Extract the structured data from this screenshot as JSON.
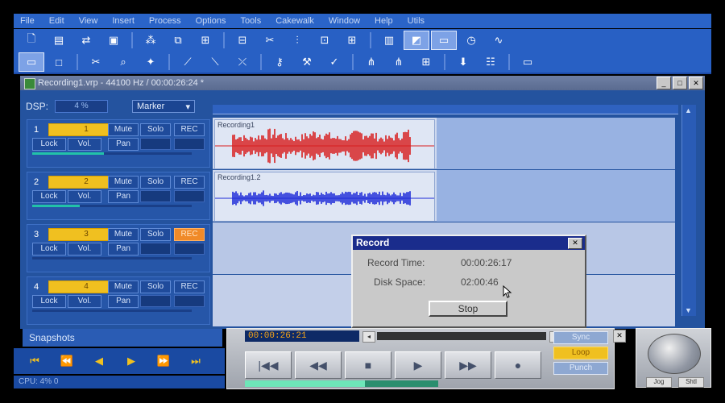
{
  "menu": [
    "File",
    "Edit",
    "View",
    "Insert",
    "Process",
    "Options",
    "Tools",
    "Cakewalk",
    "Window",
    "Help",
    "Utils"
  ],
  "document": {
    "title": "Recording1.vrp - 44100 Hz / 00:00:26:24 *"
  },
  "dsp": {
    "label": "DSP:",
    "value": "4 %"
  },
  "marker_select": "Marker",
  "tracks": [
    {
      "number": "1",
      "name": "1",
      "buttons": [
        "Mute",
        "Solo",
        "REC",
        "Lock",
        "Vol.",
        "Pan"
      ],
      "rec_armed": false,
      "fader": 0.45
    },
    {
      "number": "2",
      "name": "2",
      "buttons": [
        "Mute",
        "Solo",
        "REC",
        "Lock",
        "Vol.",
        "Pan"
      ],
      "rec_armed": false,
      "fader": 0.3
    },
    {
      "number": "3",
      "name": "3",
      "buttons": [
        "Mute",
        "Solo",
        "REC",
        "Lock",
        "Vol.",
        "Pan"
      ],
      "rec_armed": true,
      "fader": 0.0
    },
    {
      "number": "4",
      "name": "4",
      "buttons": [
        "Mute",
        "Solo",
        "REC",
        "Lock",
        "Vol.",
        "Pan"
      ],
      "rec_armed": false,
      "fader": 0.0
    }
  ],
  "clips": [
    {
      "label": "Recording1",
      "color": "#d81e1e"
    },
    {
      "label": "Recording1.2",
      "color": "#1e2ad8"
    }
  ],
  "record_dialog": {
    "title": "Record",
    "close": "✕",
    "record_time_label": "Record Time:",
    "record_time": "00:00:26:17",
    "disk_space_label": "Disk Space:",
    "disk_space": "02:00:46",
    "stop_label": "Stop"
  },
  "snapshots_label": "Snapshots",
  "status_text": "CPU: 4%  0",
  "transport": {
    "time": "00:00:26:21",
    "buttons": [
      "|◀◀",
      "◀◀",
      "■",
      "▶",
      "▶▶",
      "●"
    ],
    "level": 0.62
  },
  "modes": [
    "Sync",
    "Loop",
    "Punch"
  ],
  "active_mode": "Loop",
  "knob_labels": [
    "Jog",
    "Shtl"
  ],
  "colors": {
    "accent": "#2860c4",
    "highlight": "#f0c020"
  }
}
